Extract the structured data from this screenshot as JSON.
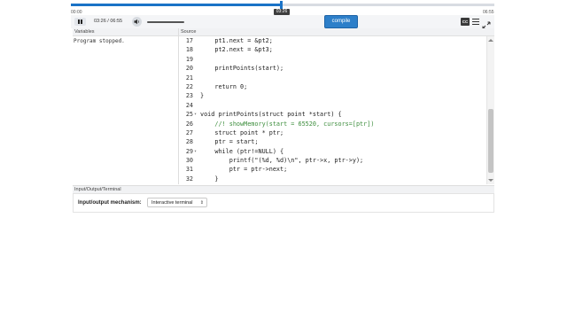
{
  "scrubber": {
    "tooltip": "03:26",
    "time_start": "00:00",
    "time_end": "06:55",
    "progress": 0.496
  },
  "controls": {
    "time_readout": "03:26 / 06:55",
    "compile_label": "compile",
    "cc_label": "CC"
  },
  "variables": {
    "header": "Variables",
    "message": "Program stopped."
  },
  "source": {
    "header": "Source",
    "lines": [
      {
        "num": "17",
        "fold": "",
        "text": "    pt1.next = &pt2;",
        "comment": false
      },
      {
        "num": "18",
        "fold": "",
        "text": "    pt2.next = &pt3;",
        "comment": false
      },
      {
        "num": "19",
        "fold": "",
        "text": "",
        "comment": false
      },
      {
        "num": "20",
        "fold": "",
        "text": "    printPoints(start);",
        "comment": false
      },
      {
        "num": "21",
        "fold": "",
        "text": "",
        "comment": false
      },
      {
        "num": "22",
        "fold": "",
        "text": "    return 0;",
        "comment": false
      },
      {
        "num": "23",
        "fold": "",
        "text": "}",
        "comment": false
      },
      {
        "num": "24",
        "fold": "",
        "text": "",
        "comment": false
      },
      {
        "num": "25",
        "fold": "▾",
        "text": "void printPoints(struct point *start) {",
        "comment": false
      },
      {
        "num": "26",
        "fold": "",
        "text": "    //! showMemory(start = 65520, cursors=[ptr])",
        "comment": true
      },
      {
        "num": "27",
        "fold": "",
        "text": "    struct point * ptr;",
        "comment": false
      },
      {
        "num": "28",
        "fold": "",
        "text": "    ptr = start;",
        "comment": false
      },
      {
        "num": "29",
        "fold": "▾",
        "text": "    while (ptr!=NULL) {",
        "comment": false
      },
      {
        "num": "30",
        "fold": "",
        "text": "        printf(\"(%d, %d)\\n\", ptr->x, ptr->y);",
        "comment": false
      },
      {
        "num": "31",
        "fold": "",
        "text": "        ptr = ptr->next;",
        "comment": false
      },
      {
        "num": "32",
        "fold": "",
        "text": "    }",
        "comment": false
      }
    ]
  },
  "io": {
    "header": "Input/Output/Terminal",
    "label": "Input/output mechanism:",
    "selected": "Interactive terminal"
  },
  "colors": {
    "accent": "#2d7fc9",
    "comment": "#3c8d3c"
  }
}
